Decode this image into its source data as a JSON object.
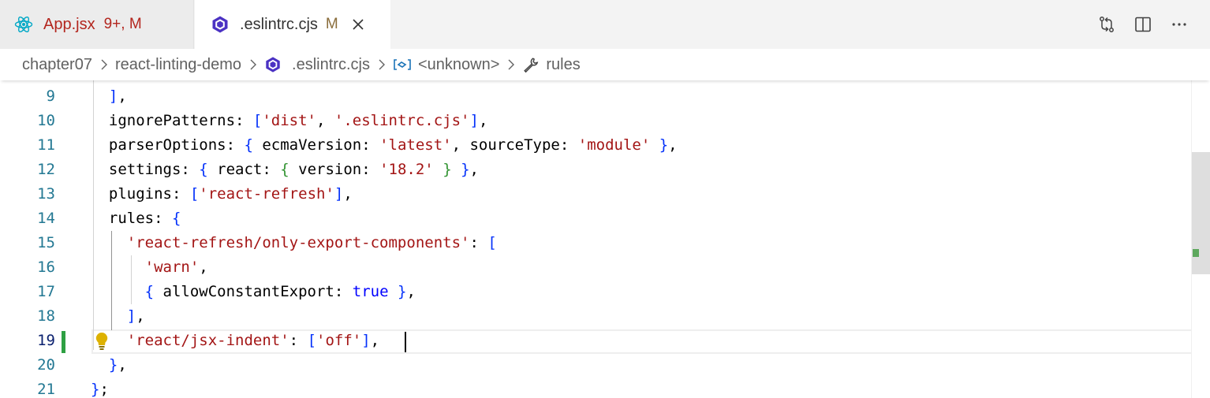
{
  "tabs": [
    {
      "name": "App.jsx",
      "badge": "9+, M",
      "icon": "react-icon"
    },
    {
      "name": ".eslintrc.cjs",
      "badge": "M",
      "icon": "eslint-icon"
    }
  ],
  "editor_actions": [
    "compare-changes-icon",
    "split-editor-icon",
    "more-actions-icon"
  ],
  "breadcrumb": {
    "items": [
      "chapter07",
      "react-linting-demo",
      ".eslintrc.cjs",
      "<unknown>",
      "rules"
    ]
  },
  "editor": {
    "active_line": 19,
    "modified_line": 19,
    "lines": [
      {
        "number": "9",
        "text": "  ],"
      },
      {
        "number": "10",
        "text": "  ignorePatterns: ['dist', '.eslintrc.cjs'],"
      },
      {
        "number": "11",
        "text": "  parserOptions: { ecmaVersion: 'latest', sourceType: 'module' },"
      },
      {
        "number": "12",
        "text": "  settings: { react: { version: '18.2' } },"
      },
      {
        "number": "13",
        "text": "  plugins: ['react-refresh'],"
      },
      {
        "number": "14",
        "text": "  rules: {"
      },
      {
        "number": "15",
        "text": "    'react-refresh/only-export-components': ["
      },
      {
        "number": "16",
        "text": "      'warn',"
      },
      {
        "number": "17",
        "text": "      { allowConstantExport: true },"
      },
      {
        "number": "18",
        "text": "    ],"
      },
      {
        "number": "19",
        "text": "    'react/jsx-indent': ['off'],"
      },
      {
        "number": "20",
        "text": "  },"
      },
      {
        "number": "21",
        "text": "};"
      }
    ]
  },
  "colors": {
    "string": "#a31515",
    "keyword": "#0000ff",
    "line_number": "#237893",
    "git_modified": "#2ea043",
    "tab_error": "#b3261e"
  }
}
